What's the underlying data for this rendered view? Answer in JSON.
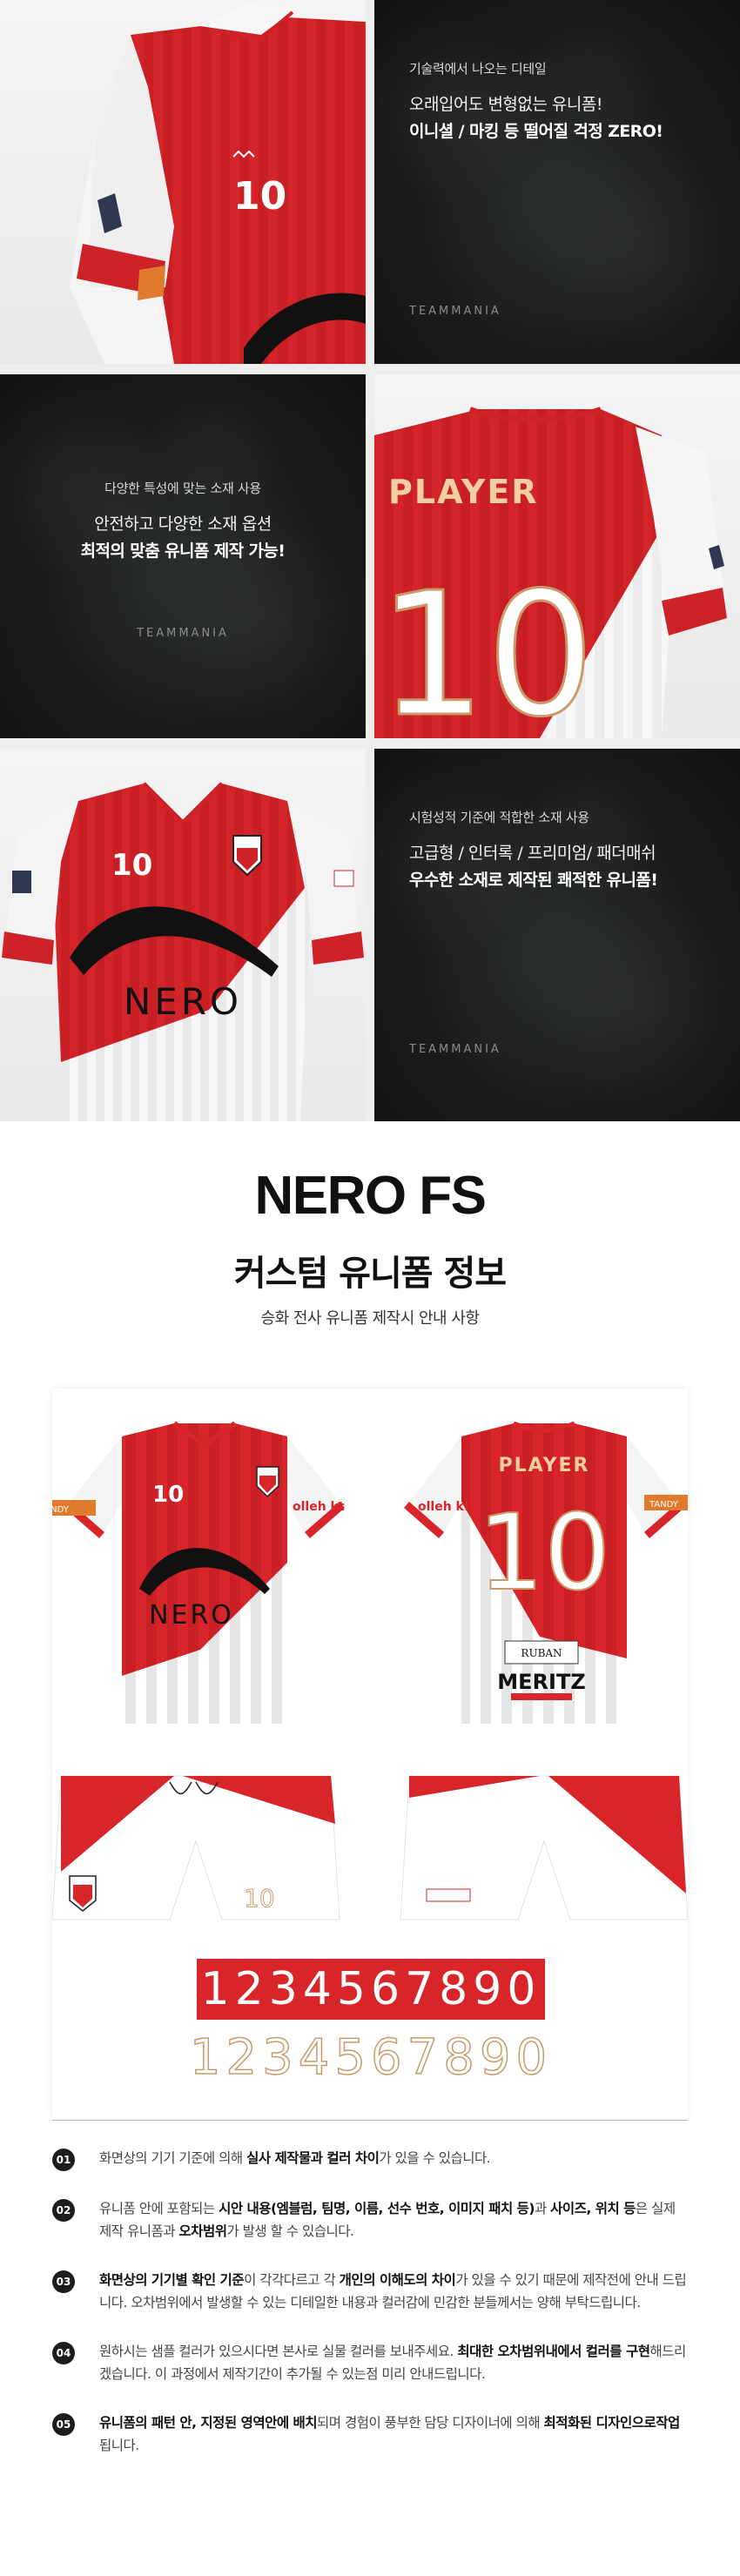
{
  "tiles": {
    "t2": {
      "small": "기술력에서 나오는 디테일",
      "line": "오래입어도 변형없는 유니폼!",
      "bold": "이니셜 / 마킹 등 떨어질 걱정 ZERO!",
      "brand": "TEAMMANIA"
    },
    "t3": {
      "small": "다양한 특성에 맞는 소재 사용",
      "line": "안전하고 다양한 소재 옵션",
      "bold": "최적의 맞춤 유니폼 제작 가능!",
      "brand": "TEAMMANIA"
    },
    "t6": {
      "small": "시험성적 기준에 적합한 소재 사용",
      "line": "고급형 / 인터록 / 프리미엄/ 패더매쉬",
      "bold": "우수한 소재로 제작된 쾌적한 유니폼!",
      "brand": "TEAMMANIA"
    }
  },
  "jersey_prints": {
    "front_number": "10",
    "player_name": "PLAYER",
    "back_number": "10",
    "brand_logo": "NERO",
    "sponsor_kt": "olleh kt",
    "sleeve_tag": "TANDY",
    "back_sponsor_top": "RUBAN",
    "back_sponsor_main": "MERITZ",
    "short_number": "10"
  },
  "header": {
    "title_en": "NERO FS",
    "title_ko": "커스텀 유니폼 정보",
    "subtitle": "승화 전사 유니폼 제작시 안내 사항"
  },
  "numbers": {
    "filled": "1234567890",
    "outline": "1234567890"
  },
  "notes": [
    {
      "num": "01",
      "parts": [
        "화면상의 기기 기준에 의해 ",
        "실사 제작물과 컬러 차이",
        "가 있을 수 있습니다."
      ]
    },
    {
      "num": "02",
      "parts": [
        "유니폼 안에 포함되는 ",
        "시안 내용(엠블럼, 팀명, 이름, 선수 번호, 이미지 패치 등)",
        "과 ",
        "사이즈, 위치 등",
        "은 실제 제작 유니폼과 ",
        "오차범위",
        "가 발생 할 수 있습니다."
      ]
    },
    {
      "num": "03",
      "parts": [
        "화면상의 기기별 확인 기준",
        "이 각각다르고 각 ",
        "개인의 이해도의 차이",
        "가 있을 수 있기 때문에 제작전에 안내 드립니다. 오차범위에서 발생할 수 있는 디테일한 내용과 컬러감에 민감한 분들께서는 양해 부탁드립니다."
      ]
    },
    {
      "num": "04",
      "parts": [
        "원하시는 샘플 컬러가 있으시다면 본사로 실물 컬러를 보내주세요. ",
        "최대한 오차범위내에서 컬러를 구현",
        "해드리겠습니다. 이 과정에서 제작기간이 추가될 수 있는점 미리 안내드립니다."
      ]
    },
    {
      "num": "05",
      "parts": [
        "유니폼의 패턴 안, 지정된 영역안에 배치",
        "되며 경험이 풍부한 담당 디자이너에 의해 ",
        "최적화된 디자인으로작업",
        "됩니다."
      ]
    }
  ],
  "colors": {
    "jersey_red": "#d7252a",
    "jersey_white": "#f6f6f6",
    "accent_gold": "#c99a6a",
    "dark_bg": "#1a1c1a"
  }
}
